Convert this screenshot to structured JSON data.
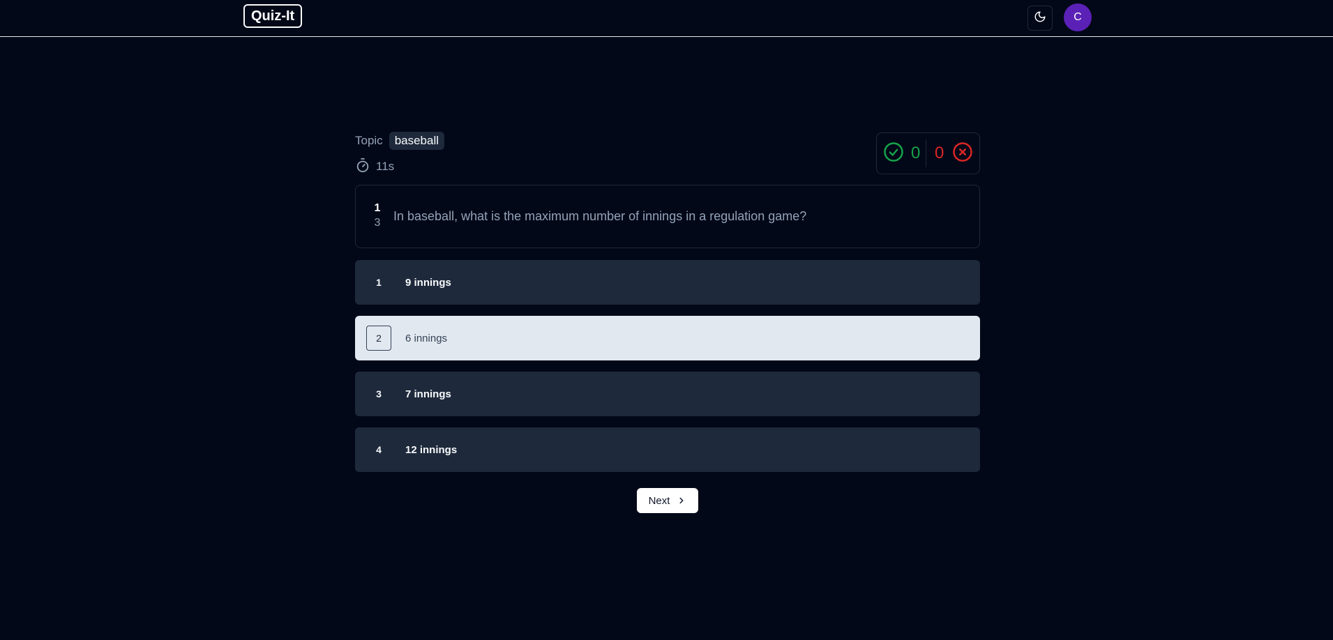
{
  "navbar": {
    "logo": "Quiz-It",
    "theme_toggle_icon": "moon-icon",
    "avatar_initial": "C",
    "avatar_color": "#5b21b6"
  },
  "quiz": {
    "topic_label": "Topic",
    "topic": "baseball",
    "timer_icon": "stopwatch-icon",
    "timer": "11s",
    "score": {
      "correct": "0",
      "wrong": "0",
      "correct_color": "#16a34a",
      "wrong_color": "#dc2626"
    },
    "question": {
      "current": "1",
      "total": "3",
      "text": "In baseball, what is the maximum number of innings in a regulation game?"
    },
    "options": [
      {
        "number": "1",
        "text": "9 innings",
        "selected": false
      },
      {
        "number": "2",
        "text": "6 innings",
        "selected": true
      },
      {
        "number": "3",
        "text": "7 innings",
        "selected": false
      },
      {
        "number": "4",
        "text": "12 innings",
        "selected": false
      }
    ],
    "next_label": "Next"
  }
}
